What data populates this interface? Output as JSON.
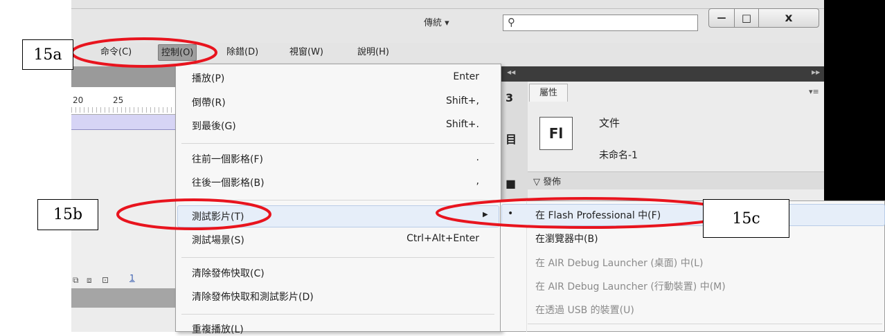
{
  "title_bar": {
    "workspace_label": "傳統 ▾",
    "search_placeholder": "",
    "window_controls": {
      "minimize": "—",
      "maximize": "□",
      "close": "x"
    }
  },
  "menu_bar": {
    "items": [
      {
        "label": "命令(C)"
      },
      {
        "label": "控制(O)",
        "active": true
      },
      {
        "label": "除錯(D)"
      },
      {
        "label": "視窗(W)"
      },
      {
        "label": "說明(H)"
      }
    ]
  },
  "timeline": {
    "ruler_labels": [
      "20",
      "25"
    ],
    "current_frame": "1"
  },
  "control_menu": {
    "items": [
      {
        "label": "播放(P)",
        "shortcut": "Enter"
      },
      {
        "label": "倒帶(R)",
        "shortcut": "Shift+,"
      },
      {
        "label": "到最後(G)",
        "shortcut": "Shift+."
      },
      {
        "label": "往前一個影格(F)",
        "shortcut": "."
      },
      {
        "label": "往後一個影格(B)",
        "shortcut": ","
      },
      {
        "label": "測試影片(T)",
        "shortcut": "",
        "highlighted": true,
        "has_submenu": true
      },
      {
        "label": "測試場景(S)",
        "shortcut": "Ctrl+Alt+Enter"
      },
      {
        "label": "清除發佈快取(C)",
        "shortcut": ""
      },
      {
        "label": "清除發佈快取和測試影片(D)",
        "shortcut": ""
      },
      {
        "label": "重複播放(L)",
        "shortcut": ""
      }
    ]
  },
  "test_movie_submenu": {
    "items": [
      {
        "label": "在 Flash Professional 中(F)",
        "checked": true,
        "enabled": true
      },
      {
        "label": "在瀏覽器中(B)",
        "enabled": true
      },
      {
        "label": "在 AIR Debug Launcher (桌面) 中(L)",
        "enabled": false
      },
      {
        "label": "在 AIR Debug Launcher (行動裝置) 中(M)",
        "enabled": false
      },
      {
        "label": "在透過 USB 的裝置(U)",
        "enabled": false
      }
    ],
    "bullet": "•"
  },
  "properties_panel": {
    "tab_label": "屬性",
    "logo_text": "Fl",
    "doc_type": "文件",
    "doc_name": "未命名-1",
    "publish_label": "▽ 發佈"
  },
  "annotations": {
    "callout_a": "15a",
    "callout_b": "15b",
    "callout_c": "15c",
    "oval_color": "#e8141e"
  }
}
